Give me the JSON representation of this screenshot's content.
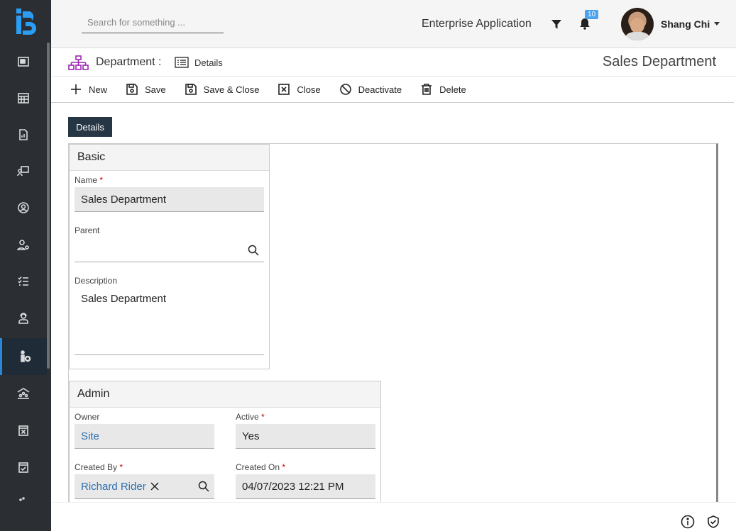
{
  "header": {
    "search_placeholder": "Search for something ...",
    "app_name": "Enterprise Application",
    "notification_count": "10",
    "user_name": "Shang Chi"
  },
  "breadcrumb": {
    "entity": "Department :",
    "view": "Details",
    "record_title": "Sales Department"
  },
  "toolbar": {
    "new": "New",
    "save": "Save",
    "save_close": "Save & Close",
    "close": "Close",
    "deactivate": "Deactivate",
    "delete": "Delete"
  },
  "tabs": {
    "details": "Details"
  },
  "basic": {
    "title": "Basic",
    "name_label": "Name",
    "name_value": "Sales Department",
    "parent_label": "Parent",
    "parent_value": "",
    "description_label": "Description",
    "description_value": "Sales Department"
  },
  "admin": {
    "title": "Admin",
    "owner_label": "Owner",
    "owner_value": "Site",
    "active_label": "Active",
    "active_value": "Yes",
    "created_by_label": "Created By",
    "created_by_value": "Richard Rider",
    "created_on_label": "Created On",
    "created_on_value": "04/07/2023 12:21 PM"
  },
  "required_mark": "*",
  "colors": {
    "sidebar": "#2b2f33",
    "tab": "#263645",
    "link": "#2c6fb2",
    "badge": "#4aa3f0"
  }
}
